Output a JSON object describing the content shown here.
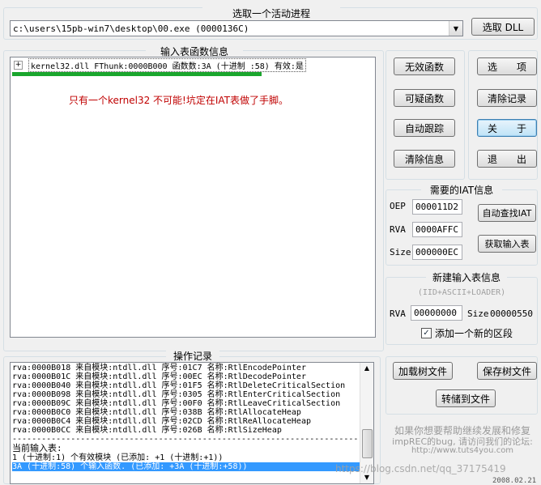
{
  "process": {
    "title": "选取一个活动进程",
    "selected": "c:\\users\\15pb-win7\\desktop\\00.exe (0000136C)",
    "dll_button": "选取 DLL"
  },
  "imports": {
    "title": "输入表函数信息",
    "tree_item": "kernel32.dll FThunk:0000B000 函数数:3A (十进制 :58) 有效:是",
    "annotation": "只有一个kernel32 不可能!坑定在IAT表做了手脚。"
  },
  "buttons_mid": {
    "invalid": "无效函数",
    "suspicious": "可疑函数",
    "auto_trace": "自动跟踪",
    "clear_info": "清除信息"
  },
  "buttons_right": {
    "options": "选　　项",
    "clear_log": "清除记录",
    "about": "关　　于",
    "exit": "退　　出"
  },
  "iat": {
    "title": "需要的IAT信息",
    "oep_label": "OEP",
    "oep": "000011D2",
    "rva_label": "RVA",
    "rva": "0000AFFC",
    "size_label": "Size",
    "size": "000000EC",
    "auto_find": "自动查找IAT",
    "get_imports": "获取输入表"
  },
  "newimp": {
    "title": "新建输入表信息",
    "subtitle": "(IID+ASCII+LOADER)",
    "rva_label": "RVA",
    "rva": "00000000",
    "size_label": "Size",
    "size": "00000550",
    "add_section": "添加一个新的区段"
  },
  "log": {
    "title": "操作记录",
    "lines": [
      "rva:0000B018 来自模块:ntdll.dll 序号:01C7 名称:RtlEncodePointer",
      "rva:0000B01C 来自模块:ntdll.dll 序号:00EC 名称:RtlDecodePointer",
      "rva:0000B040 来自模块:ntdll.dll 序号:01F5 名称:RtlDeleteCriticalSection",
      "rva:0000B098 来自模块:ntdll.dll 序号:0305 名称:RtlEnterCriticalSection",
      "rva:0000B09C 来自模块:ntdll.dll 序号:00F0 名称:RtlLeaveCriticalSection",
      "rva:0000B0C0 来自模块:ntdll.dll 序号:038B 名称:RtlAllocateHeap",
      "rva:0000B0C4 来自模块:ntdll.dll 序号:02CD 名称:RtlReAllocateHeap",
      "rva:0000B0CC 来自模块:ntdll.dll 序号:026B 名称:RtlSizeHeap"
    ],
    "separator": "------------------------------------------------------------------------",
    "current_label": "当前输入表:",
    "summary": "1 (十进制:1) 个有效模块 (已添加: +1 (十进制:+1))",
    "highlight": "3A (十进制:58) 个输入函数. (已添加: +3A (十进制:+58))"
  },
  "tree_buttons": {
    "load": "加载树文件",
    "save": "保存树文件",
    "dump": "转储到文件"
  },
  "promo": {
    "line1": "如果你想要帮助继续发展和修复",
    "line2": "impREC的bug, 请访问我们的论坛:",
    "url": "http://www.tuts4you.com"
  },
  "watermark": "https://blog.csdn.net/qq_37175419",
  "date": "2008.02.21"
}
